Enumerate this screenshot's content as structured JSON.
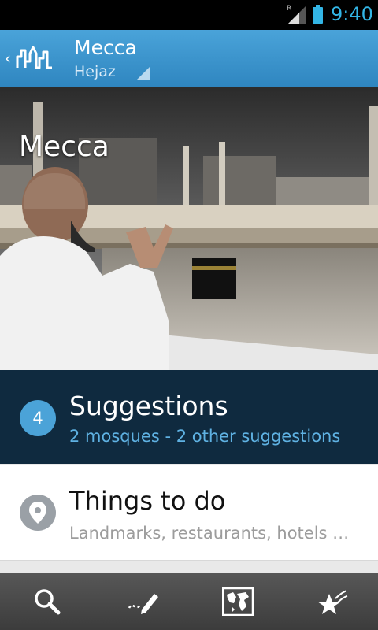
{
  "status_bar": {
    "time": "9:40",
    "roaming_indicator": "R"
  },
  "action_bar": {
    "title": "Mecca",
    "subtitle": "Hejaz"
  },
  "hero": {
    "title": "Mecca"
  },
  "suggestions": {
    "count": "4",
    "title": "Suggestions",
    "subtitle": "2 mosques - 2 other suggestions"
  },
  "things_to_do": {
    "title": "Things to do",
    "subtitle": "Landmarks, restaurants, hotels …"
  },
  "bottom_bar": {
    "icons": [
      "search-icon",
      "write-review-icon",
      "map-icon",
      "favorites-icon"
    ]
  },
  "colors": {
    "accent": "#33b5e5",
    "action_bar": "#3a95cf",
    "suggestions_bg": "#0f2a3f",
    "badge": "#4ba3d8"
  }
}
